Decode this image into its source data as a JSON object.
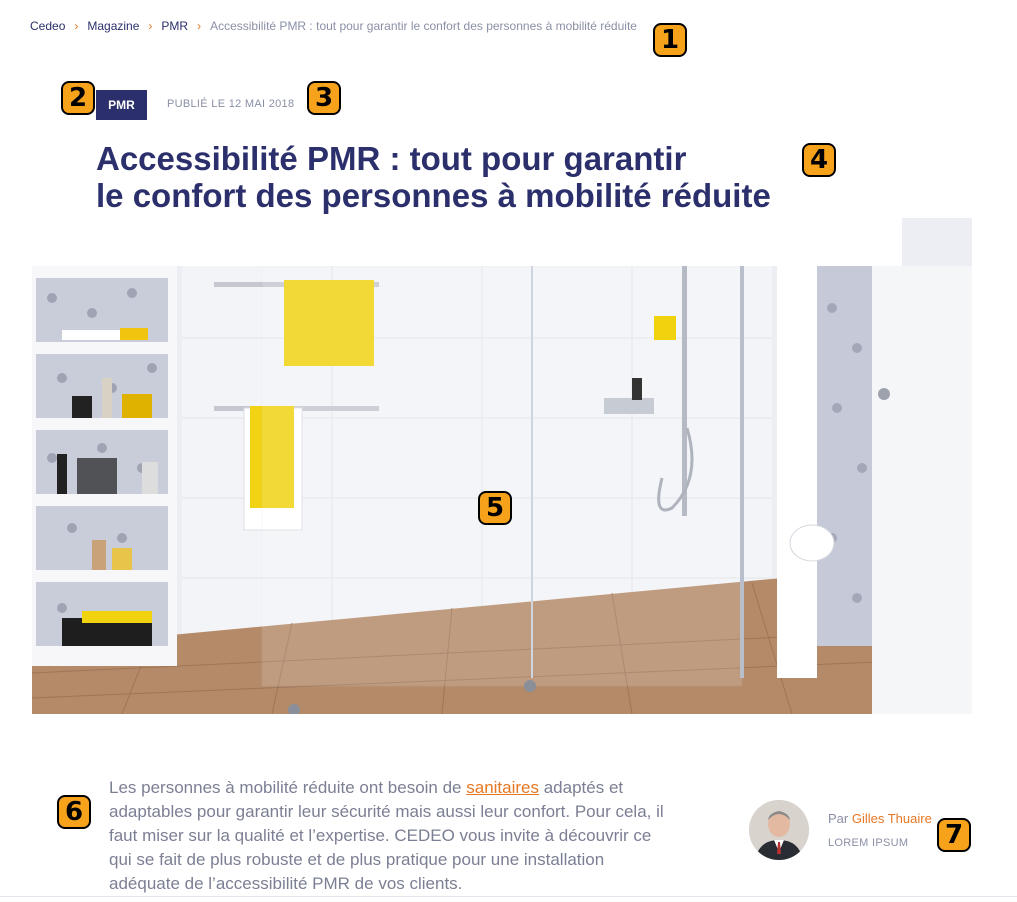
{
  "breadcrumb": {
    "items": [
      "Cedeo",
      "Magazine",
      "PMR"
    ],
    "current": "Accessibilité PMR : tout pour garantir le confort des personnes à mobilité réduite"
  },
  "article": {
    "category_tag": "PMR",
    "published": "PUBLIÉ LE 12 MAI 2018",
    "title_line1": "Accessibilité PMR : tout pour garantir",
    "title_line2": "le confort des personnes à mobilité réduite",
    "intro_before": "Les personnes à mobilité réduite ont besoin de ",
    "intro_link": "sanitaires",
    "intro_after": " adaptés et adaptables pour garantir leur sécurité mais aussi leur confort. Pour cela, il faut miser sur la qualité et l’expertise. CEDEO vous invite à découvrir ce qui se fait de plus robuste et de plus pratique pour une installation adéquate de l’accessibilité PMR de vos clients."
  },
  "author": {
    "prefix": "Par ",
    "name": "Gilles Thuaire",
    "role": "LOREM IPSUM"
  },
  "annotations": [
    "1",
    "2",
    "3",
    "4",
    "5",
    "6",
    "7"
  ],
  "colors": {
    "brand_navy": "#2b2f6b",
    "accent_orange": "#e87722",
    "muted_text": "#8a8fa6",
    "badge": "#f7a21b"
  }
}
